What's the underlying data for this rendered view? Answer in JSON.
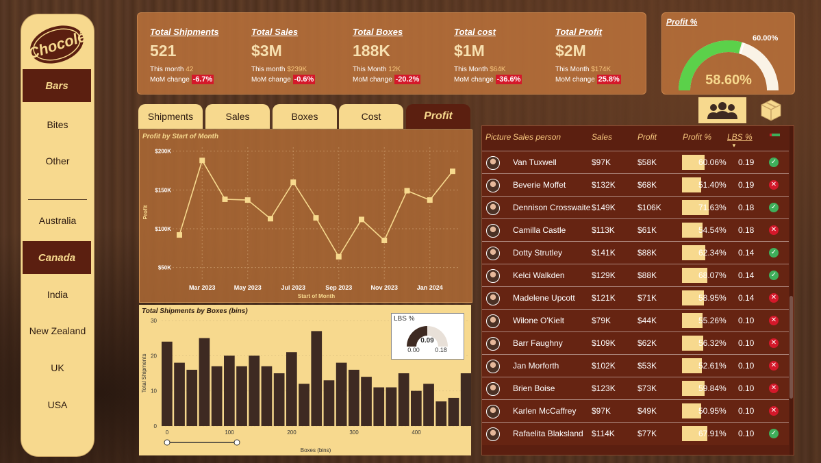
{
  "brand": {
    "logo_text": "Chocolé"
  },
  "sidebar": {
    "items": [
      {
        "label": "Bars",
        "active": true
      },
      {
        "label": "Bites",
        "active": false
      },
      {
        "label": "Other",
        "active": false
      },
      {
        "label": "Australia",
        "active": false
      },
      {
        "label": "Canada",
        "active": true
      },
      {
        "label": "India",
        "active": false
      },
      {
        "label": "New Zealand",
        "active": false
      },
      {
        "label": "UK",
        "active": false
      },
      {
        "label": "USA",
        "active": false
      }
    ]
  },
  "kpis": [
    {
      "title": "Total Shipments",
      "value": "521",
      "month_label": "This month",
      "month_value": "42",
      "change_label": "MoM change",
      "change_value": "-6.7%"
    },
    {
      "title": "Total Sales",
      "value": "$3M",
      "month_label": "This month",
      "month_value": "$239K",
      "change_label": "MoM change",
      "change_value": "-0.6%"
    },
    {
      "title": "Total Boxes",
      "value": "188K",
      "month_label": "This Month",
      "month_value": "12K",
      "change_label": "MoM change",
      "change_value": "-20.2%"
    },
    {
      "title": "Total cost",
      "value": "$1M",
      "month_label": "This Month",
      "month_value": "$64K",
      "change_label": "MoM change",
      "change_value": "-36.6%"
    },
    {
      "title": "Total Profit",
      "value": "$2M",
      "month_label": "This Month",
      "month_value": "$174K",
      "change_label": "MoM change",
      "change_value": "25.8%"
    }
  ],
  "gauge": {
    "title": "Profit %",
    "value": 58.6,
    "value_label": "58.60%",
    "target": 60.0,
    "target_label": "60.00%",
    "color": "#5bd14a"
  },
  "tabs": [
    {
      "label": "Shipments",
      "active": false
    },
    {
      "label": "Sales",
      "active": false
    },
    {
      "label": "Boxes",
      "active": false
    },
    {
      "label": "Cost",
      "active": false
    },
    {
      "label": "Profit",
      "active": true
    }
  ],
  "view_buttons": [
    {
      "icon": "people-icon",
      "active": true
    },
    {
      "icon": "box-icon",
      "active": false
    }
  ],
  "chart_data": [
    {
      "type": "line",
      "title": "Profit by Start of Month",
      "xlabel": "Start of Month",
      "ylabel": "Profit",
      "x_ticks": [
        "Mar 2023",
        "May 2023",
        "Jul 2023",
        "Sep 2023",
        "Nov 2023",
        "Jan 2024"
      ],
      "y_ticks": [
        "$50K",
        "$100K",
        "$150K",
        "$200K"
      ],
      "ylim": [
        40000,
        205000
      ],
      "x": [
        "2023-02",
        "2023-03",
        "2023-04",
        "2023-05",
        "2023-06",
        "2023-07",
        "2023-08",
        "2023-09",
        "2023-10",
        "2023-11",
        "2023-12",
        "2024-01",
        "2024-02"
      ],
      "values": [
        92000,
        188000,
        138000,
        137000,
        113000,
        160000,
        114000,
        64000,
        112000,
        85000,
        149000,
        137000,
        174000
      ],
      "color": "#f7d98e"
    },
    {
      "type": "bar",
      "title": "Total Shipments by Boxes (bins)",
      "xlabel": "Boxes (bins)",
      "ylabel": "Total Shipments",
      "x_ticks": [
        "0",
        "100",
        "200",
        "300",
        "400"
      ],
      "y_ticks": [
        "0",
        "10",
        "20",
        "30"
      ],
      "ylim": [
        0,
        30
      ],
      "bin_width": 20,
      "values": [
        24,
        18,
        16,
        25,
        17,
        20,
        17,
        20,
        17,
        15,
        21,
        12,
        27,
        13,
        18,
        16,
        14,
        11,
        11,
        15,
        10,
        12,
        7,
        8,
        15
      ],
      "color": "#3e2a22"
    }
  ],
  "lbs_card": {
    "title": "LBS %",
    "value": "0.09",
    "min": "0.00",
    "max": "0.18",
    "fraction": 0.5
  },
  "table": {
    "headers": {
      "picture": "Picture",
      "person": "Sales person",
      "sales": "Sales",
      "profit": "Profit",
      "profit_pct": "Profit %",
      "lbs": "LBS %"
    },
    "rows": [
      {
        "name": "Van Tuxwell",
        "sales": "$97K",
        "profit": "$58K",
        "pct": "60.06%",
        "pct_value": 60.06,
        "lbs": "0.19",
        "ok": true
      },
      {
        "name": "Beverie Moffet",
        "sales": "$132K",
        "profit": "$68K",
        "pct": "51.40%",
        "pct_value": 51.4,
        "lbs": "0.19",
        "ok": false
      },
      {
        "name": "Dennison Crosswaite",
        "sales": "$149K",
        "profit": "$106K",
        "pct": "71.63%",
        "pct_value": 71.63,
        "lbs": "0.18",
        "ok": true
      },
      {
        "name": "Camilla Castle",
        "sales": "$113K",
        "profit": "$61K",
        "pct": "54.54%",
        "pct_value": 54.54,
        "lbs": "0.18",
        "ok": false
      },
      {
        "name": "Dotty Strutley",
        "sales": "$141K",
        "profit": "$88K",
        "pct": "62.34%",
        "pct_value": 62.34,
        "lbs": "0.14",
        "ok": true
      },
      {
        "name": "Kelci Walkden",
        "sales": "$129K",
        "profit": "$88K",
        "pct": "68.07%",
        "pct_value": 68.07,
        "lbs": "0.14",
        "ok": true
      },
      {
        "name": "Madelene Upcott",
        "sales": "$121K",
        "profit": "$71K",
        "pct": "58.95%",
        "pct_value": 58.95,
        "lbs": "0.14",
        "ok": false
      },
      {
        "name": "Wilone O'Kielt",
        "sales": "$79K",
        "profit": "$44K",
        "pct": "55.26%",
        "pct_value": 55.26,
        "lbs": "0.10",
        "ok": false
      },
      {
        "name": "Barr Faughny",
        "sales": "$109K",
        "profit": "$62K",
        "pct": "56.32%",
        "pct_value": 56.32,
        "lbs": "0.10",
        "ok": false
      },
      {
        "name": "Jan Morforth",
        "sales": "$102K",
        "profit": "$53K",
        "pct": "52.61%",
        "pct_value": 52.61,
        "lbs": "0.10",
        "ok": false
      },
      {
        "name": "Brien Boise",
        "sales": "$123K",
        "profit": "$73K",
        "pct": "59.84%",
        "pct_value": 59.84,
        "lbs": "0.10",
        "ok": false
      },
      {
        "name": "Karlen McCaffrey",
        "sales": "$97K",
        "profit": "$49K",
        "pct": "50.95%",
        "pct_value": 50.95,
        "lbs": "0.10",
        "ok": false
      },
      {
        "name": "Rafaelita Blaksland",
        "sales": "$114K",
        "profit": "$77K",
        "pct": "67.91%",
        "pct_value": 67.91,
        "lbs": "0.10",
        "ok": true
      }
    ]
  }
}
